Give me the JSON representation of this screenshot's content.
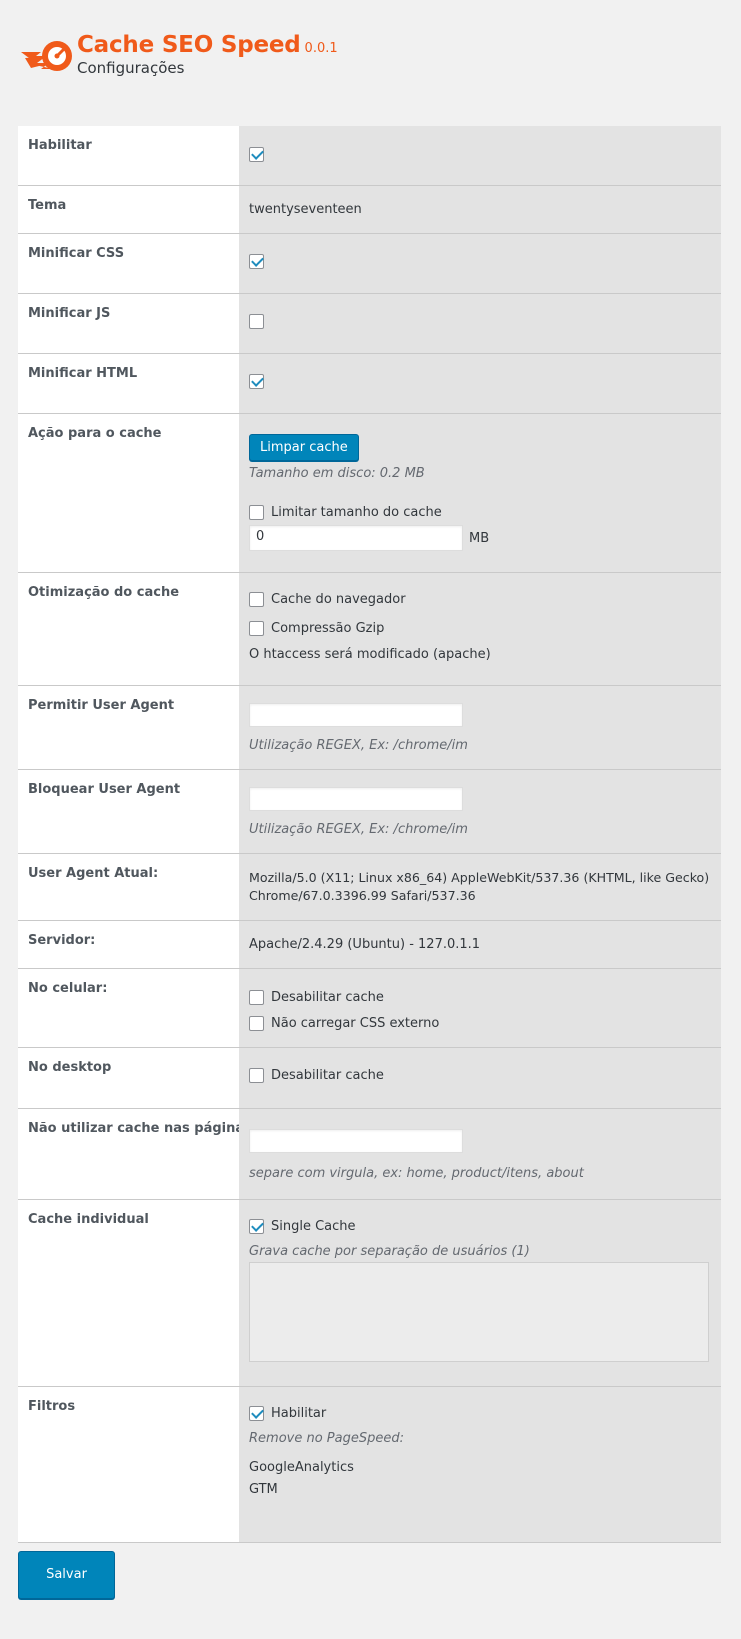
{
  "header": {
    "title": "Cache SEO Speed",
    "version": "0.0.1",
    "subtitle": "Configurações",
    "logo_icon": "flame-logo-icon",
    "brand_color": "#f05a1a"
  },
  "settings": {
    "habilitar": {
      "label": "Habilitar",
      "checked": true
    },
    "tema": {
      "label": "Tema",
      "value": "twentyseventeen"
    },
    "minificar_css": {
      "label": "Minificar CSS",
      "checked": true
    },
    "minificar_js": {
      "label": "Minificar JS",
      "checked": false
    },
    "minificar_html": {
      "label": "Minificar HTML",
      "checked": true
    },
    "acao_cache": {
      "label": "Ação para o cache",
      "button_label": "Limpar cache",
      "disk_size": "Tamanho em disco: 0.2 MB",
      "limit_label": "Limitar tamanho do cache",
      "limit_checked": false,
      "limit_value": "0",
      "limit_unit": "MB"
    },
    "otimizacao": {
      "label": "Otimização do cache",
      "browser_cache_label": "Cache do navegador",
      "browser_cache_checked": false,
      "gzip_label": "Compressão Gzip",
      "gzip_checked": false,
      "note": "O htaccess será modificado (apache)"
    },
    "permitir_ua": {
      "label": "Permitir User Agent",
      "value": "",
      "hint": "Utilização REGEX, Ex: /chrome/im"
    },
    "bloquear_ua": {
      "label": "Bloquear User Agent",
      "value": "",
      "hint": "Utilização REGEX, Ex: /chrome/im"
    },
    "ua_atual": {
      "label": "User Agent Atual:",
      "line1": "Mozilla/5.0 (X11; Linux x86_64) AppleWebKit/537.36 (KHTML, like Gecko)",
      "line2": "Chrome/67.0.3396.99 Safari/537.36"
    },
    "servidor": {
      "label": "Servidor:",
      "value": "Apache/2.4.29 (Ubuntu) - 127.0.1.1"
    },
    "celular": {
      "label": "No celular:",
      "disable_cache_label": "Desabilitar cache",
      "disable_cache_checked": false,
      "no_css_label": "Não carregar CSS externo",
      "no_css_checked": false
    },
    "desktop": {
      "label": "No desktop",
      "disable_cache_label": "Desabilitar cache",
      "disable_cache_checked": false
    },
    "nao_utilizar": {
      "label": "Não utilizar cache nas páginas",
      "value": "",
      "hint": "separe com virgula, ex: home, product/itens, about"
    },
    "cache_individual": {
      "label": "Cache individual",
      "single_label": "Single Cache",
      "single_checked": true,
      "hint": "Grava cache por separação de usuários (1)",
      "textarea_value": ""
    },
    "filtros": {
      "label": "Filtros",
      "enable_label": "Habilitar",
      "enable_checked": true,
      "hint": "Remove no PageSpeed:",
      "items": [
        "GoogleAnalytics",
        "GTM"
      ]
    }
  },
  "footer": {
    "save_label": "Salvar"
  },
  "colors": {
    "primary_button": "#0085ba",
    "label_bg": "#ffffff",
    "value_bg": "#e3e3e3",
    "page_bg": "#f1f1f1",
    "checkmark": "#1e8cbe"
  }
}
